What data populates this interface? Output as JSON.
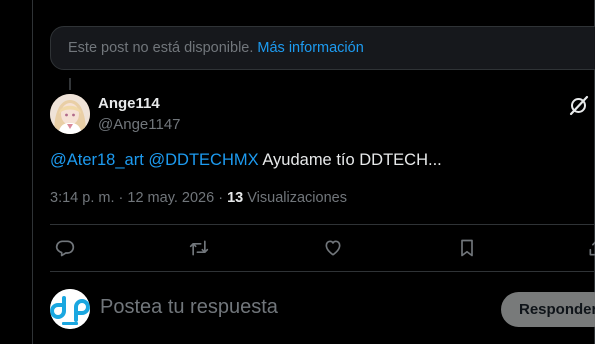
{
  "notice": {
    "text": "Este post no está disponible.",
    "link_label": "Más información"
  },
  "post": {
    "author_name": "Ange114",
    "author_handle": "@Ange1147",
    "mention_1": "@Ater18_art",
    "mention_2": "@DDTECHMX",
    "body_text": "Ayudame tío DDTECH...",
    "time": "3:14 p. m.",
    "sep": "·",
    "date": "12 may. 2026",
    "views_count": "13",
    "views_label": "Visualizaciones"
  },
  "actions": {
    "icons": [
      "reply-icon",
      "repost-icon",
      "like-icon",
      "bookmark-icon",
      "share-icon"
    ]
  },
  "reply_box": {
    "placeholder": "Postea tu respuesta",
    "button_label": "Responder"
  },
  "colors": {
    "background": "#000000",
    "accent": "#1d9bf0",
    "muted": "#71767b",
    "text": "#e7e9ea",
    "border": "#2f3336"
  }
}
